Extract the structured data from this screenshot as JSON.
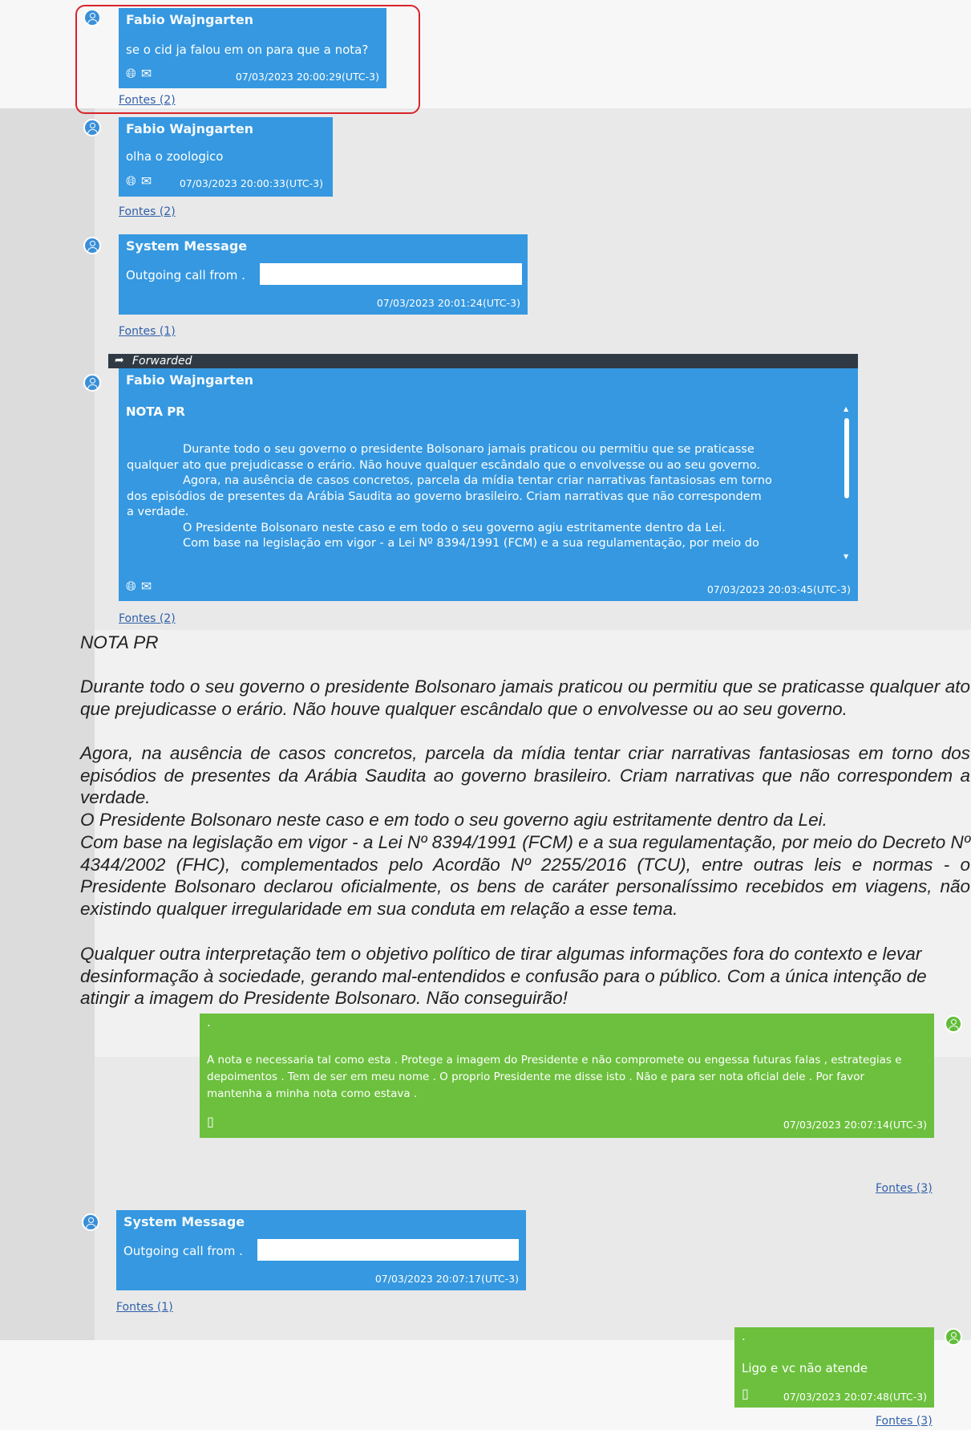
{
  "messages": [
    {
      "sender": "Fabio Wajngarten",
      "text": "se o cid ja falou em on para que a nota?",
      "timestamp": "07/03/2023 20:00:29(UTC-3)",
      "fontes": "Fontes (2)"
    },
    {
      "sender": "Fabio Wajngarten",
      "text": "olha o zoologico",
      "timestamp": "07/03/2023 20:00:33(UTC-3)",
      "fontes": "Fontes (2)"
    },
    {
      "sender": "System Message",
      "text": "Outgoing call from .",
      "timestamp": "07/03/2023 20:01:24(UTC-3)",
      "fontes": "Fontes (1)"
    },
    {
      "forwarded": "Forwarded",
      "sender": "Fabio Wajngarten",
      "title": "NOTA PR",
      "body": [
        "Durante todo o seu governo o presidente Bolsonaro jamais praticou ou permitiu que se praticasse",
        "qualquer ato que prejudicasse o erário. Não houve qualquer escândalo que o envolvesse ou ao seu governo.",
        "Agora, na ausência de casos concretos, parcela da mídia tentar criar narrativas fantasiosas em torno",
        "dos episódios de presentes da Arábia Saudita ao governo brasileiro. Criam narrativas que não correspondem",
        "a verdade.",
        "O Presidente Bolsonaro neste caso e em todo o seu governo agiu estritamente dentro da Lei.",
        "Com base na legislação em vigor - a Lei Nº 8394/1991 (FCM) e a sua regulamentação, por meio do"
      ],
      "timestamp": "07/03/2023 20:03:45(UTC-3)",
      "fontes": "Fontes (2)"
    },
    {
      "dot": ".",
      "text": "A nota e necessaria tal como esta .  Protege a imagem do Presidente e não compromete ou engessa futuras falas ,  estrategias e depoimentos . Tem de ser em meu nome . O proprio Presidente me disse isto .  Não e para ser nota oficial dele .   Por favor mantenha a minha nota como estava .",
      "timestamp": "07/03/2023 20:07:14(UTC-3)",
      "fontes": "Fontes (3)"
    },
    {
      "sender": "System Message",
      "text": "Outgoing call from .",
      "timestamp": "07/03/2023 20:07:17(UTC-3)",
      "fontes": "Fontes (1)"
    },
    {
      "dot": ".",
      "text": "Ligo e vc não atende",
      "timestamp": "07/03/2023 20:07:48(UTC-3)",
      "fontes": "Fontes (3)"
    }
  ],
  "document": {
    "title": "NOTA PR",
    "paragraphs": [
      "Durante todo o seu governo o presidente Bolsonaro jamais praticou ou permitiu que se praticasse qualquer ato que prejudicasse o erário. Não houve qualquer escândalo que o envolvesse ou ao seu governo.",
      "Agora, na ausência de casos concretos, parcela da mídia tentar criar narrativas fantasiosas em torno dos episódios de presentes da Arábia Saudita ao governo brasileiro. Criam narrativas que não correspondem a verdade.",
      "O Presidente Bolsonaro neste caso e em todo o seu governo agiu estritamente dentro da Lei.",
      "Com base na legislação em vigor - a Lei Nº 8394/1991 (FCM) e a sua regulamentação, por meio do Decreto Nº 4344/2002 (FHC), complementados pelo Acordão Nº 2255/2016 (TCU), entre outras leis e normas - o Presidente Bolsonaro declarou oficialmente, os bens de caráter personalíssimo recebidos em viagens, não existindo qualquer irregularidade em sua conduta em relação a esse tema.",
      "Qualquer outra interpretação tem o objetivo político de tirar algumas informações fora do contexto e levar desinformação à sociedade, gerando mal-entendidos e confusão para o público. Com a única intenção de atingir a imagem do Presidente Bolsonaro. Não conseguirão!"
    ]
  },
  "icons": {
    "globe": "globe-icon",
    "mail": "mail-icon",
    "phone": "phone-icon",
    "avatar": "user-avatar-icon",
    "forward": "forward-arrow-icon"
  },
  "colors": {
    "blue_bubble": "#3598e0",
    "green_bubble": "#6cc03d",
    "forward_bar": "#2f3a44",
    "highlight": "#d9242a",
    "link": "#2f5fa8"
  }
}
